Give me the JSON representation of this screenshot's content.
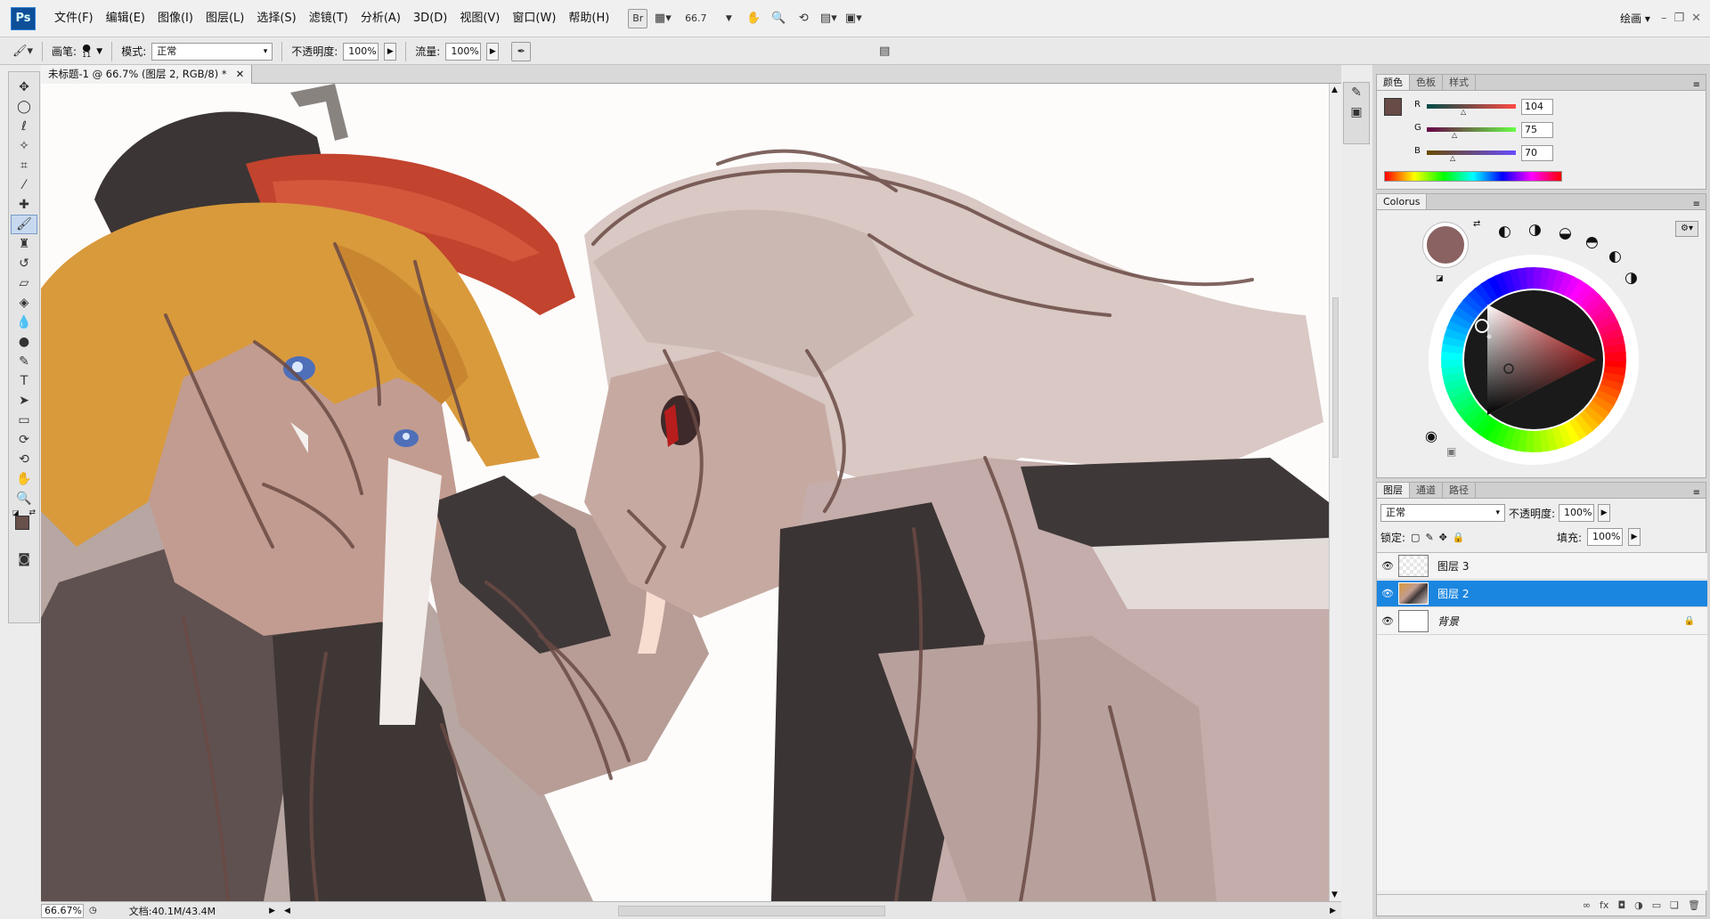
{
  "app": {
    "logo": "Ps",
    "workspace": "绘画 ▾"
  },
  "menu": [
    "文件(F)",
    "编辑(E)",
    "图像(I)",
    "图层(L)",
    "选择(S)",
    "滤镜(T)",
    "分析(A)",
    "3D(D)",
    "视图(V)",
    "窗口(W)",
    "帮助(H)"
  ],
  "toolbar_top": {
    "br": "Br",
    "zoom": "66.7"
  },
  "options": {
    "brush_label": "画笔:",
    "brush_size": "11",
    "mode_label": "模式:",
    "mode_value": "正常",
    "opacity_label": "不透明度:",
    "opacity_value": "100%",
    "flow_label": "流量:",
    "flow_value": "100%"
  },
  "document": {
    "tab_title": "未标题-1 @ 66.7% (图层 2, RGB/8) *",
    "status_zoom": "66.67%",
    "status_doc": "文档:40.1M/43.4M"
  },
  "color_panel": {
    "tabs": [
      "颜色",
      "色板",
      "样式"
    ],
    "r_label": "R",
    "g_label": "G",
    "b_label": "B",
    "r": 104,
    "g": 75,
    "b": 70,
    "fg_color": "#684b46"
  },
  "colorwheel": {
    "title": "Colorus"
  },
  "layers_panel": {
    "tabs": [
      "图层",
      "通道",
      "路径"
    ],
    "blend_mode": "正常",
    "opacity_label": "不透明度:",
    "opacity": "100%",
    "lock_label": "锁定:",
    "fill_label": "填充:",
    "fill": "100%",
    "layers": [
      {
        "name": "图层 3",
        "selected": false
      },
      {
        "name": "图层 2",
        "selected": true
      },
      {
        "name": "背景",
        "selected": false
      }
    ]
  }
}
